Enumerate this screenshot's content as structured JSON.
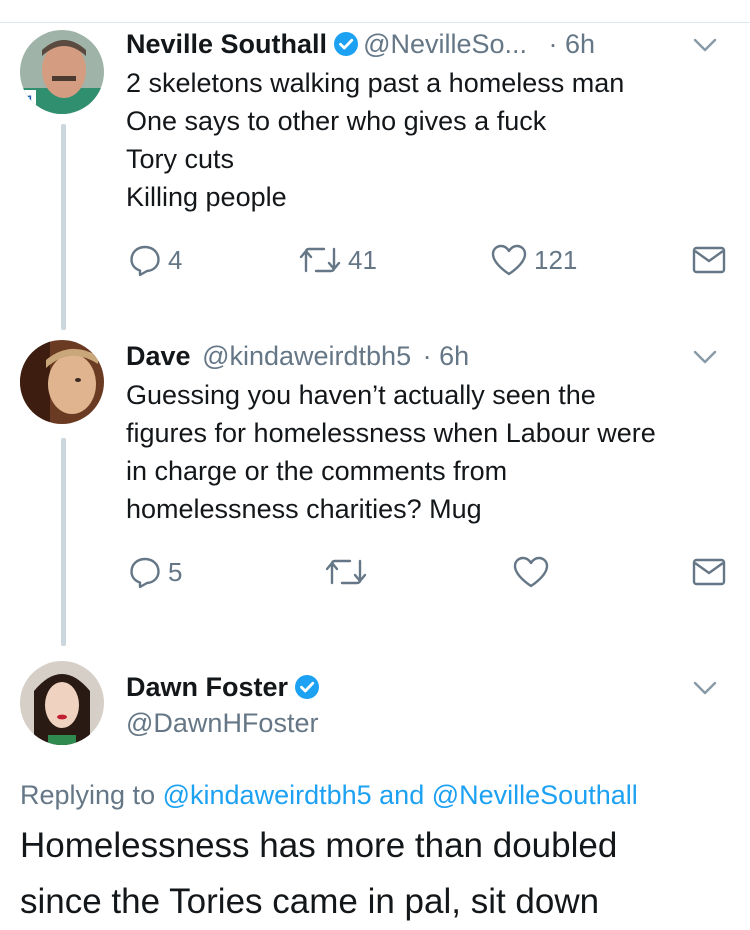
{
  "tweets": [
    {
      "name": "Neville Southall",
      "handle": "@NevilleSo...",
      "time": "· 6h",
      "verified": true,
      "text_lines": [
        "2 skeletons walking past a homeless man",
        "One says to other who gives a fuck",
        "Tory cuts",
        "Killing people"
      ],
      "replies": "4",
      "retweets": "41",
      "likes": "121"
    },
    {
      "name": "Dave",
      "handle": "@kindaweirdtbh5",
      "time": "· 6h",
      "verified": false,
      "text_lines": [
        "Guessing you haven’t actually seen the",
        "figures for homelessness when Labour were",
        "in charge or the comments from",
        "homelessness charities? Mug"
      ],
      "replies": "5",
      "retweets": "",
      "likes": ""
    },
    {
      "name": "Dawn Foster",
      "handle": "@DawnHFoster",
      "verified": true
    }
  ],
  "replying": {
    "prefix": "Replying to",
    "user1": "@kindaweirdtbh5",
    "and": "and",
    "user2": "@NevilleSouthall"
  },
  "main_text_lines": [
    "Homelessness has more than doubled",
    "since the Tories came in pal, sit down"
  ],
  "colors": {
    "verified": "#1da1f2",
    "link": "#1da1f2",
    "muted": "#657786",
    "thread_line": "#ccd6dd"
  },
  "icons": [
    "reply-icon",
    "retweet-icon",
    "heart-icon",
    "dm-icon",
    "chevron-down-icon",
    "verified-badge-icon"
  ]
}
